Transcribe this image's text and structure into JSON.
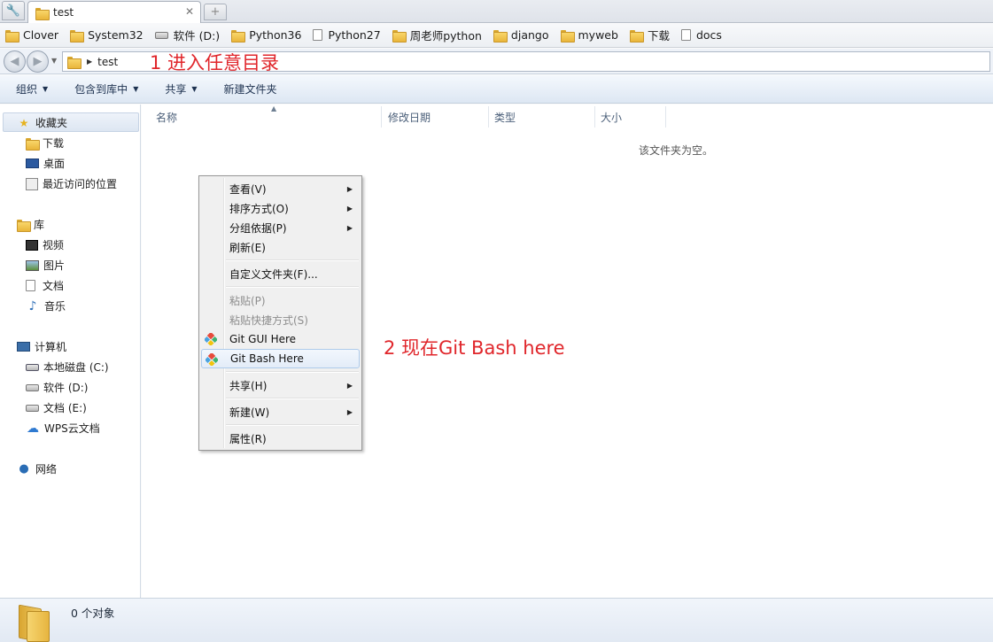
{
  "tabbar": {
    "tools_icon": "wrench-icon",
    "active_tab": {
      "label": "test",
      "icon": "folder-icon"
    },
    "close_glyph": "✕",
    "new_tab_glyph": "+"
  },
  "bookmarks": [
    {
      "label": "Clover",
      "icon": "folder-icon"
    },
    {
      "label": "System32",
      "icon": "folder-icon"
    },
    {
      "label": "软件 (D:)",
      "icon": "drive-icon"
    },
    {
      "label": "Python36",
      "icon": "folder-icon"
    },
    {
      "label": "Python27",
      "icon": "page-icon"
    },
    {
      "label": "周老师python",
      "icon": "folder-icon"
    },
    {
      "label": "django",
      "icon": "folder-icon"
    },
    {
      "label": "myweb",
      "icon": "folder-icon"
    },
    {
      "label": "下载",
      "icon": "download-folder-icon"
    },
    {
      "label": "docs",
      "icon": "page-icon"
    }
  ],
  "address": {
    "crumb": "test",
    "annotation": "1 进入任意目录"
  },
  "commandbar": {
    "organize": "组织",
    "include_in_library": "包含到库中",
    "share": "共享",
    "new_folder": "新建文件夹"
  },
  "navpane": {
    "favorites": {
      "label": "收藏夹",
      "items": [
        "下载",
        "桌面",
        "最近访问的位置"
      ]
    },
    "libraries": {
      "label": "库",
      "items": [
        "视频",
        "图片",
        "文档",
        "音乐"
      ]
    },
    "computer": {
      "label": "计算机",
      "items": [
        "本地磁盘 (C:)",
        "软件 (D:)",
        "文档 (E:)",
        "WPS云文档"
      ]
    },
    "network": {
      "label": "网络"
    }
  },
  "columns": [
    "名称",
    "修改日期",
    "类型",
    "大小"
  ],
  "empty_message": "该文件夹为空。",
  "context_menu": {
    "items": [
      {
        "label": "查看(V)",
        "submenu": true
      },
      {
        "label": "排序方式(O)",
        "submenu": true
      },
      {
        "label": "分组依据(P)",
        "submenu": true
      },
      {
        "label": "刷新(E)"
      },
      {
        "label": "自定义文件夹(F)..."
      },
      {
        "label": "粘贴(P)",
        "disabled": true
      },
      {
        "label": "粘贴快捷方式(S)",
        "disabled": true
      },
      {
        "label": "Git GUI Here",
        "icon": "git-icon"
      },
      {
        "label": "Git Bash Here",
        "icon": "git-icon",
        "highlighted": true
      },
      {
        "label": "共享(H)",
        "submenu": true
      },
      {
        "label": "新建(W)",
        "submenu": true
      },
      {
        "label": "属性(R)"
      }
    ]
  },
  "annotation2": "2 现在Git Bash here",
  "statusbar": {
    "text": "0 个对象"
  },
  "colors": {
    "annotation_red": "#e0262b",
    "command_bar": "#dde7f3",
    "menu_hover_border": "#aecbeb"
  }
}
